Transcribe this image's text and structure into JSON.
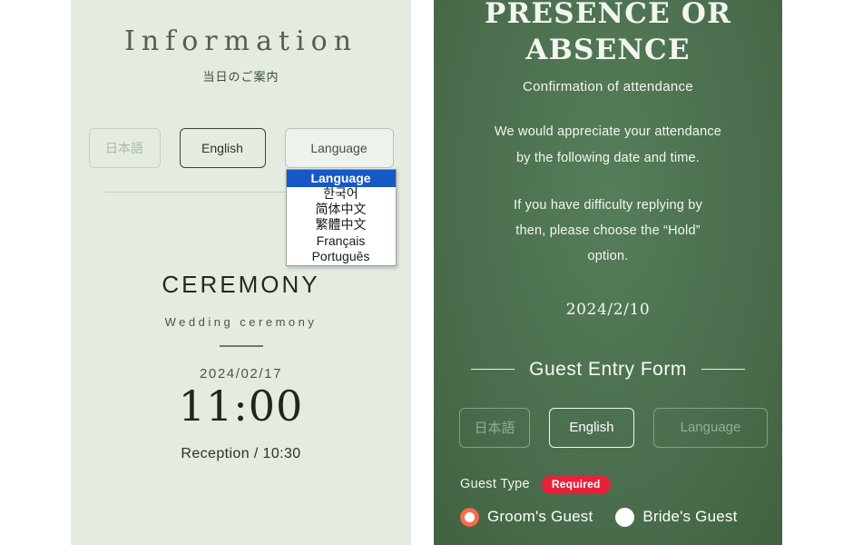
{
  "left_panel": {
    "title": "Information",
    "subtitle": "当日のご案内",
    "language_buttons": [
      {
        "label": "日本語",
        "state": "disabled"
      },
      {
        "label": "English",
        "state": "active"
      }
    ],
    "language_select": {
      "value": "Language",
      "options": [
        "Language",
        "한국어",
        "简体中文",
        "繁體中文",
        "Français",
        "Português"
      ],
      "selected_option": "Language",
      "expanded": "true"
    },
    "ceremony": {
      "title": "CEREMONY",
      "subtitle": "Wedding ceremony",
      "date": "2024/02/17",
      "time": "11:00",
      "reception": "Reception / 10:30"
    }
  },
  "right_panel": {
    "title_line1": "PRESENCE OR",
    "title_line2": "ABSENCE",
    "subtitle": "Confirmation of attendance",
    "paragraph1_line1": "We would appreciate your attendance",
    "paragraph1_line2": "by the following date and time.",
    "paragraph2_line1": "If you have difficulty replying by",
    "paragraph2_line2": "then, please choose the “Hold”",
    "paragraph2_line3": "option.",
    "deadline_date": "2024/2/10",
    "form_heading": "Guest Entry Form",
    "language_buttons": [
      {
        "label": "日本語",
        "state": "dim"
      },
      {
        "label": "English",
        "state": "active"
      },
      {
        "label": "Language",
        "state": "dim"
      }
    ],
    "guest_type": {
      "label": "Guest Type",
      "required_badge": "Required",
      "options": [
        {
          "label": "Groom's Guest",
          "checked": "true"
        },
        {
          "label": "Bride's Guest",
          "checked": "false"
        }
      ]
    }
  },
  "colors": {
    "left_bg": "#e4ece1",
    "right_bg": "#4c7150",
    "accent_required": "#e8213a",
    "accent_radio": "#f2704f",
    "select_highlight": "#1558c6"
  }
}
